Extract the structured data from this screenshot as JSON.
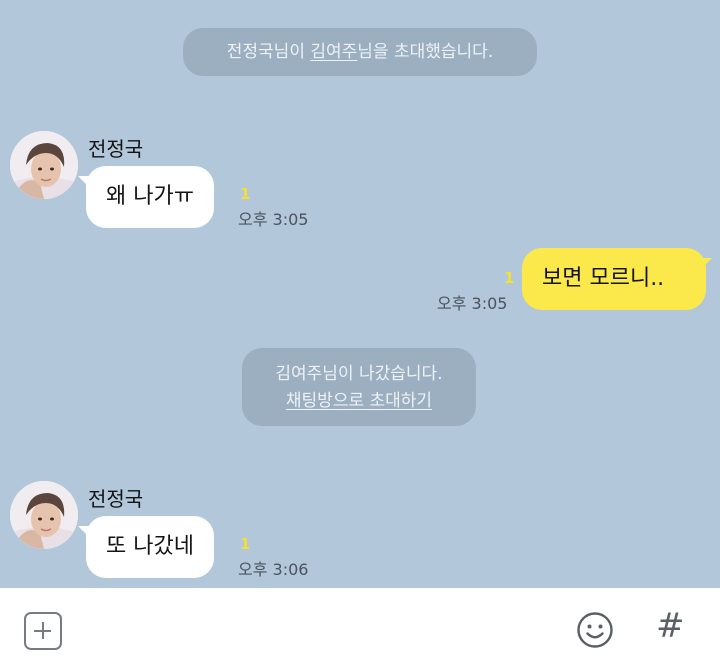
{
  "system_1": {
    "prefix": "전정국님이 ",
    "invitee": "김여주",
    "suffix": "님을 초대했습니다."
  },
  "system_2": {
    "line1": "김여주님이 나갔습니다.",
    "link": "채팅방으로 초대하기"
  },
  "messages": [
    {
      "sender": "전정국",
      "text": "왜 나가ㅠ",
      "unread": "1",
      "time": "오후 3:05"
    },
    {
      "text": "보면 모르니..",
      "unread": "1",
      "time": "오후 3:05"
    },
    {
      "sender": "전정국",
      "text": "또 나갔네",
      "unread": "1",
      "time": "오후 3:06"
    }
  ],
  "colors": {
    "background": "#b2c7da",
    "incoming_bubble": "#ffffff",
    "outgoing_bubble": "#fbe94b",
    "unread": "#f5df32"
  },
  "input_bar": {
    "hash_label": "#",
    "icons": [
      "plus-square-icon",
      "smile-icon"
    ]
  }
}
